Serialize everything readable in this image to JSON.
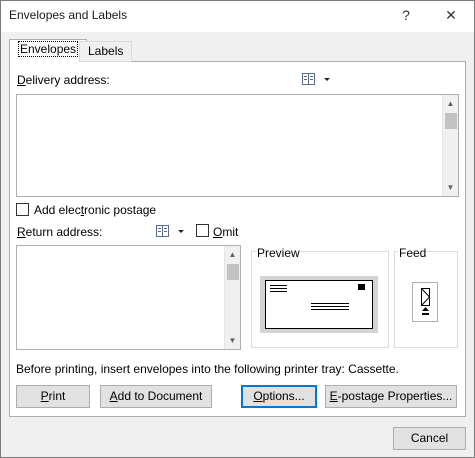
{
  "window": {
    "title": "Envelopes and Labels",
    "help_glyph": "?",
    "close_glyph": "✕"
  },
  "tabs": [
    {
      "label": "Envelopes",
      "selected": true
    },
    {
      "label": "Labels",
      "selected": false
    }
  ],
  "delivery": {
    "label_first": "D",
    "label_rest": "elivery address:",
    "value": ""
  },
  "postage": {
    "label_pre": "Add elec",
    "label_ul": "t",
    "label_post": "ronic postage",
    "checked": false
  },
  "return_addr": {
    "label_first": "R",
    "label_rest": "eturn address:",
    "value": "",
    "omit_label_pre": "",
    "omit_label_ul": "O",
    "omit_label_post": "mit",
    "omit_checked": false
  },
  "preview": {
    "label": "Preview"
  },
  "feed": {
    "label": "Feed"
  },
  "printer_note": "Before printing, insert envelopes into the following printer tray: Cassette.",
  "buttons": {
    "print_ul": "P",
    "print_rest": "rint",
    "add_pre": "",
    "add_ul": "A",
    "add_rest": "dd to Document",
    "options_pre": "",
    "options_ul": "O",
    "options_rest": "ptions...",
    "epostage_pre": "",
    "epostage_ul": "E",
    "epostage_rest": "-postage Properties...",
    "cancel": "Cancel"
  },
  "icons": {
    "address_book": "address-book-icon",
    "dropdown": "chevron-down-icon"
  },
  "colors": {
    "focus_border": "#0078d7",
    "dialog_bg": "#f0f0f0",
    "button_bg": "#e1e1e1"
  }
}
